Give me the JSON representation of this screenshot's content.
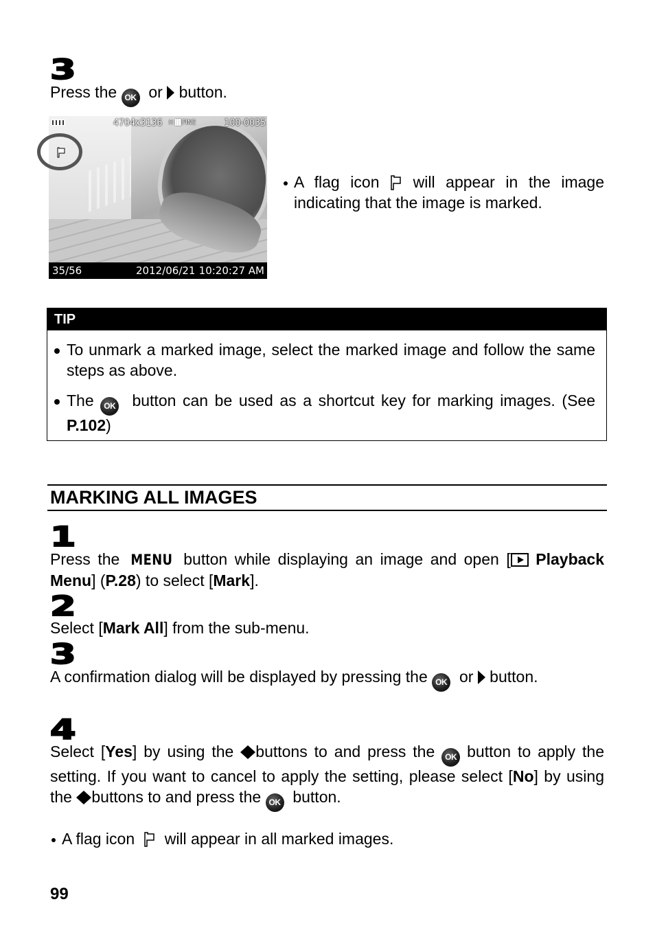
{
  "step3_top": {
    "number": "3",
    "text_before_ok": "Press the",
    "ok_label": "OK",
    "text_or": "or",
    "text_after": "button."
  },
  "camera_screen": {
    "resolution": "4704x3136",
    "quality": "FINE",
    "quality_prefix": "H",
    "file_number": "100-0035",
    "frame_counter": "35/56",
    "date": "2012/06/21",
    "time": "10:20:27 AM"
  },
  "flag_note": {
    "text_before_icon": "A flag icon",
    "text_after_icon": "will appear in the image indicating that the image is marked."
  },
  "tip": {
    "heading": "TIP",
    "item1": "To unmark a marked image, select the marked image and follow the same steps as above.",
    "item2_before_ok": "The",
    "item2_ok_label": "OK",
    "item2_after_ok": "button can be used as a shortcut key for marking images. (See",
    "item2_ref": "P.102",
    "item2_end": ")"
  },
  "section": {
    "title": "MARKING ALL IMAGES"
  },
  "steps": [
    {
      "number": "1",
      "t1": "Press the",
      "menu_label": "MENU",
      "t2": "button while displaying an image and open [",
      "bold1": "Playback Menu",
      "t3": "] (",
      "bold2": "P.28",
      "t4": ") to select [",
      "bold3": "Mark",
      "t5": "]."
    },
    {
      "number": "2",
      "t1": "Select [",
      "bold1": "Mark All",
      "t2": "] from the sub-menu."
    },
    {
      "number": "3",
      "t1": "A confirmation dialog will be displayed by pressing the",
      "ok_label": "OK",
      "t2": "or",
      "t3": "button."
    },
    {
      "number": "4",
      "t1": "Select [",
      "bold1": "Yes",
      "t2": "] by using the",
      "t3": "buttons to and press the",
      "ok_label": "OK",
      "t4": "button to apply the setting. If you want to cancel to apply the setting, please select [",
      "bold2": "No",
      "t5": "] by using the",
      "t6": "buttons to and press the",
      "t7": "button."
    }
  ],
  "final_note": {
    "text_before_icon": "A flag icon",
    "text_after_icon": "will appear in all marked images."
  },
  "page_number": "99"
}
